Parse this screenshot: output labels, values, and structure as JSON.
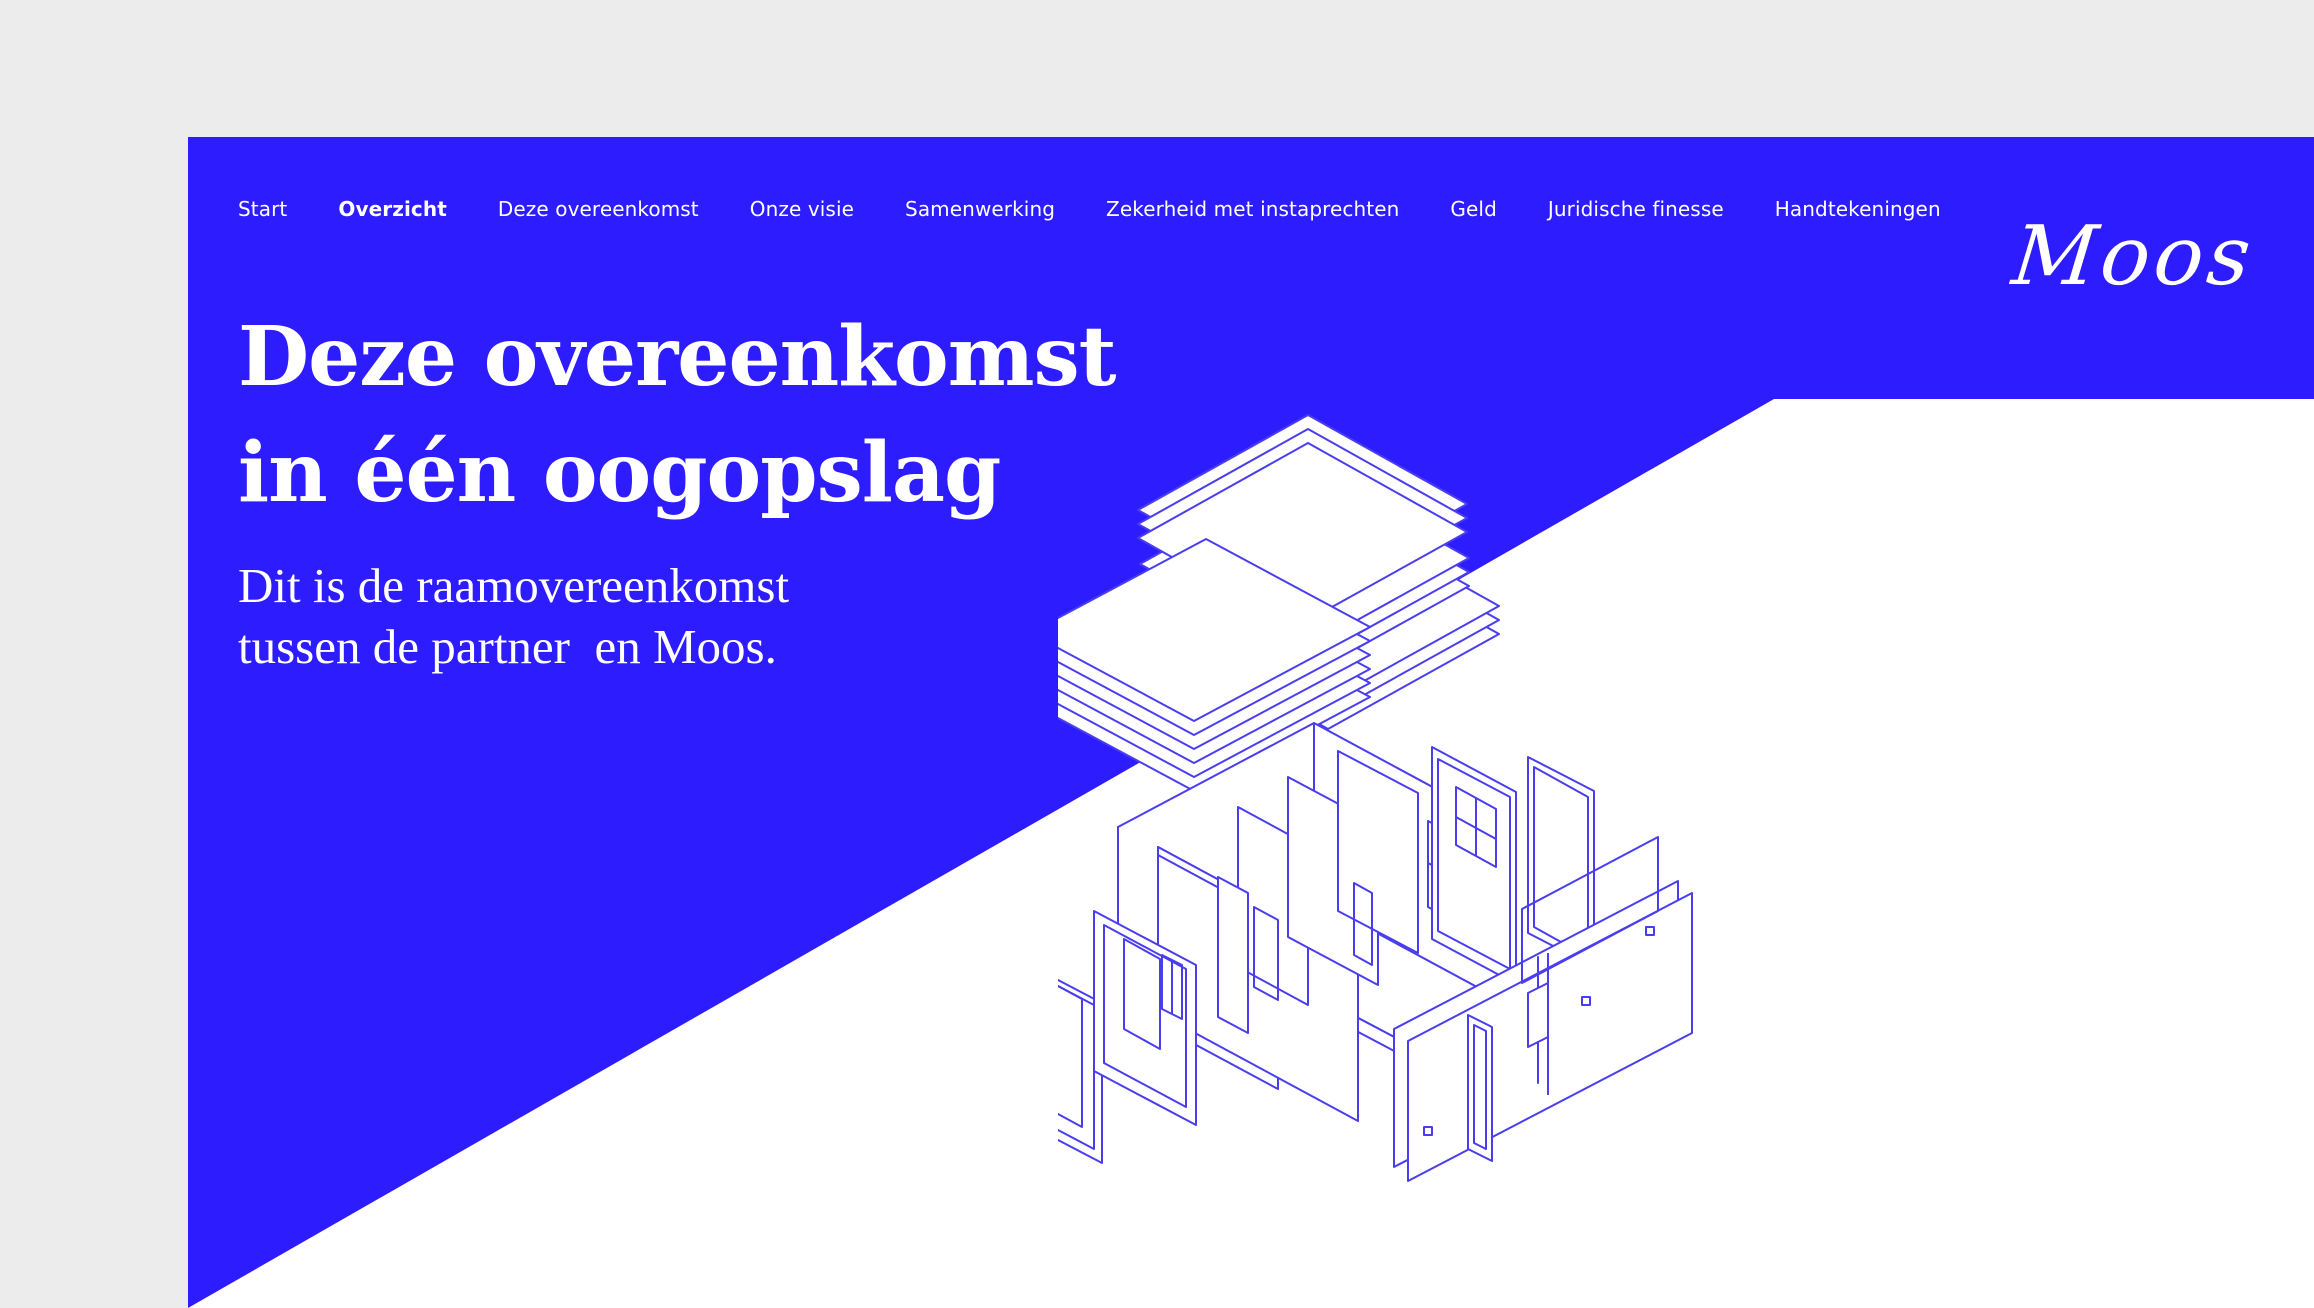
{
  "nav": {
    "items": [
      {
        "label": "Start",
        "active": false
      },
      {
        "label": "Overzicht",
        "active": true
      },
      {
        "label": "Deze overeenkomst",
        "active": false
      },
      {
        "label": "Onze visie",
        "active": false
      },
      {
        "label": "Samenwerking",
        "active": false
      },
      {
        "label": "Zekerheid met instaprechten",
        "active": false
      },
      {
        "label": "Geld",
        "active": false
      },
      {
        "label": "Juridische finesse",
        "active": false
      },
      {
        "label": "Handtekeningen",
        "active": false
      }
    ]
  },
  "logo": {
    "text": "Moos",
    "icon": "moos-signature-logo"
  },
  "hero": {
    "title_line1": "Deze overeenkomst",
    "title_line2": "in één oogopslag",
    "subtitle_line1": "Dit is de raamovereenkomst",
    "subtitle_line2": "tussen de partner  en Moos."
  },
  "illustration": {
    "icon": "exploded-isometric-house-icon"
  },
  "colors": {
    "brand_blue": "#2d1dfe",
    "line_blue": "#4a3df0",
    "white": "#ffffff",
    "outer_bg": "#ececec"
  }
}
